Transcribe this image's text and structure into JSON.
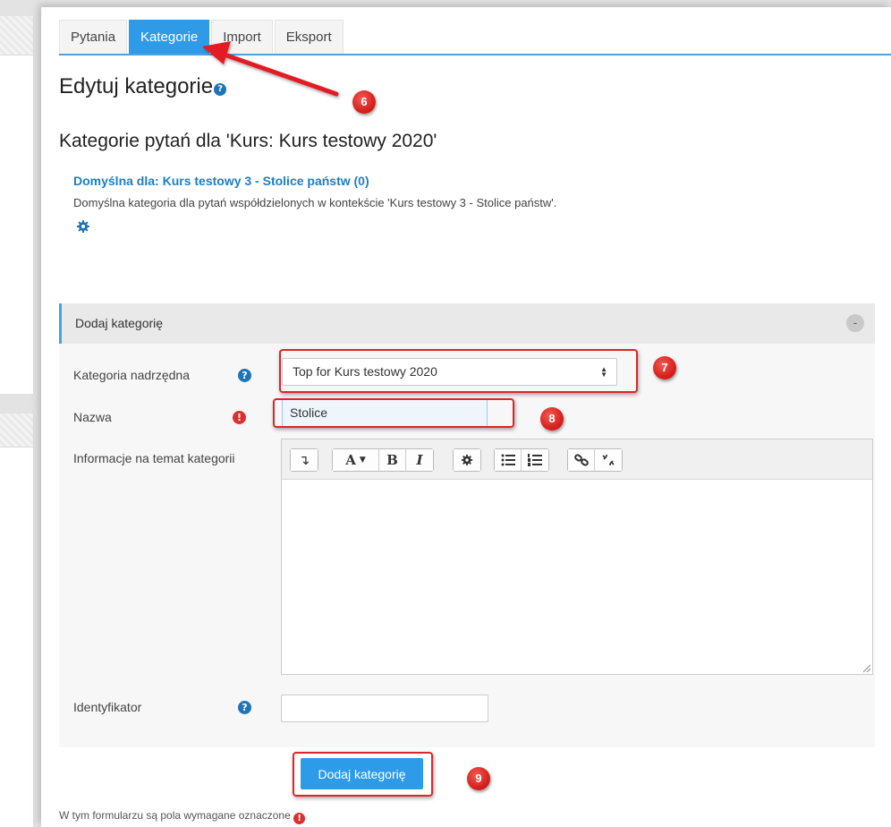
{
  "tabs": [
    {
      "label": "Pytania",
      "active": false
    },
    {
      "label": "Kategorie",
      "active": true
    },
    {
      "label": "Import",
      "active": false
    },
    {
      "label": "Eksport",
      "active": false
    }
  ],
  "page": {
    "heading": "Edytuj kategorie",
    "subheading": "Kategorie pytań dla 'Kurs: Kurs testowy 2020'"
  },
  "category_list": {
    "link": "Domyślna dla: Kurs testowy 3 - Stolice państw (0)",
    "description": "Domyślna kategoria dla pytań współdzielonych w kontekście 'Kurs testowy 3 - Stolice państw'."
  },
  "form": {
    "section_title": "Dodaj kategorię",
    "collapse_symbol": "-",
    "parent_label": "Kategoria nadrzędna",
    "parent_value": "Top for Kurs testowy 2020",
    "parent_arrows": "◆",
    "name_label": "Nazwa",
    "name_value": "Stolice",
    "info_label": "Informacje na temat kategorii",
    "id_label": "Identyfikator",
    "id_value": "",
    "submit_label": "Dodaj kategorię",
    "required_note": "W tym formularzu są pola wymagane oznaczone"
  },
  "editor_toolbar": {
    "collapse": "↴",
    "font": "A",
    "bold": "B",
    "italic": "I"
  },
  "icons": {
    "help": "?",
    "error": "!"
  },
  "annotations": [
    "6",
    "7",
    "8",
    "9"
  ],
  "colors": {
    "accent": "#2f9be8",
    "link": "#1a7fc9",
    "annotation": "#e0242b",
    "required": "#d9312f"
  }
}
